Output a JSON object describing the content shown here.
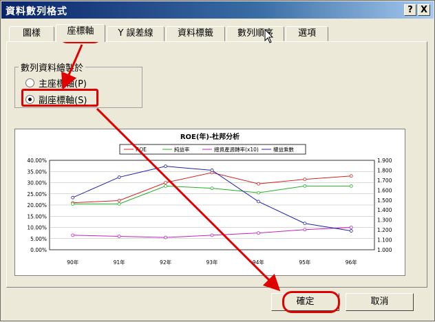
{
  "window": {
    "title": "資料數列格式",
    "help_label": "?",
    "close_label": "X"
  },
  "tabs": [
    {
      "label": "圖樣"
    },
    {
      "label": "座標軸"
    },
    {
      "label": "Y 誤差線"
    },
    {
      "label": "資料標籤"
    },
    {
      "label": "數列順序"
    },
    {
      "label": "選項"
    }
  ],
  "plot_group": {
    "label": "數列資料繪製於",
    "options": [
      {
        "label": "主座標軸(P)",
        "selected": false
      },
      {
        "label": "副座標軸(S)",
        "selected": true
      }
    ]
  },
  "buttons": {
    "ok_label": "確定",
    "cancel_label": "取消"
  },
  "colors": {
    "accent": "#e00000",
    "title_bar": "#0a246a"
  },
  "chart_data": {
    "type": "line",
    "title": "ROE(年)-杜邦分析",
    "categories": [
      "90年",
      "91年",
      "92年",
      "93年",
      "94年",
      "95年",
      "96年"
    ],
    "y_left_ticks": [
      "0.00%",
      "5.00%",
      "10.00%",
      "15.00%",
      "20.00%",
      "25.00%",
      "30.00%",
      "35.00%",
      "40.00%"
    ],
    "y_right_ticks": [
      "1.000",
      "1.100",
      "1.200",
      "1.300",
      "1.400",
      "1.500",
      "1.600",
      "1.700",
      "1.800",
      "1.900"
    ],
    "ylim_left": [
      0,
      40
    ],
    "ylim_right": [
      1.0,
      1.9
    ],
    "legend_position": "top",
    "series": [
      {
        "name": "ROE",
        "color": "#d62020",
        "axis": "left",
        "values": [
          21.0,
          22.0,
          30.0,
          34.5,
          29.5,
          31.5,
          33.0
        ]
      },
      {
        "name": "純益率",
        "color": "#22b022",
        "axis": "left",
        "values": [
          20.5,
          20.5,
          28.5,
          27.5,
          25.5,
          28.5,
          28.5
        ]
      },
      {
        "name": "總資產週轉率(x10)",
        "color": "#c020c0",
        "axis": "left",
        "values": [
          6.5,
          6.0,
          5.5,
          6.5,
          7.5,
          9.0,
          10.0
        ]
      },
      {
        "name": "權益乘數",
        "color": "#2020b0",
        "axis": "right",
        "values": [
          1.525,
          1.73,
          1.84,
          1.8,
          1.485,
          1.265,
          1.19
        ]
      }
    ]
  }
}
